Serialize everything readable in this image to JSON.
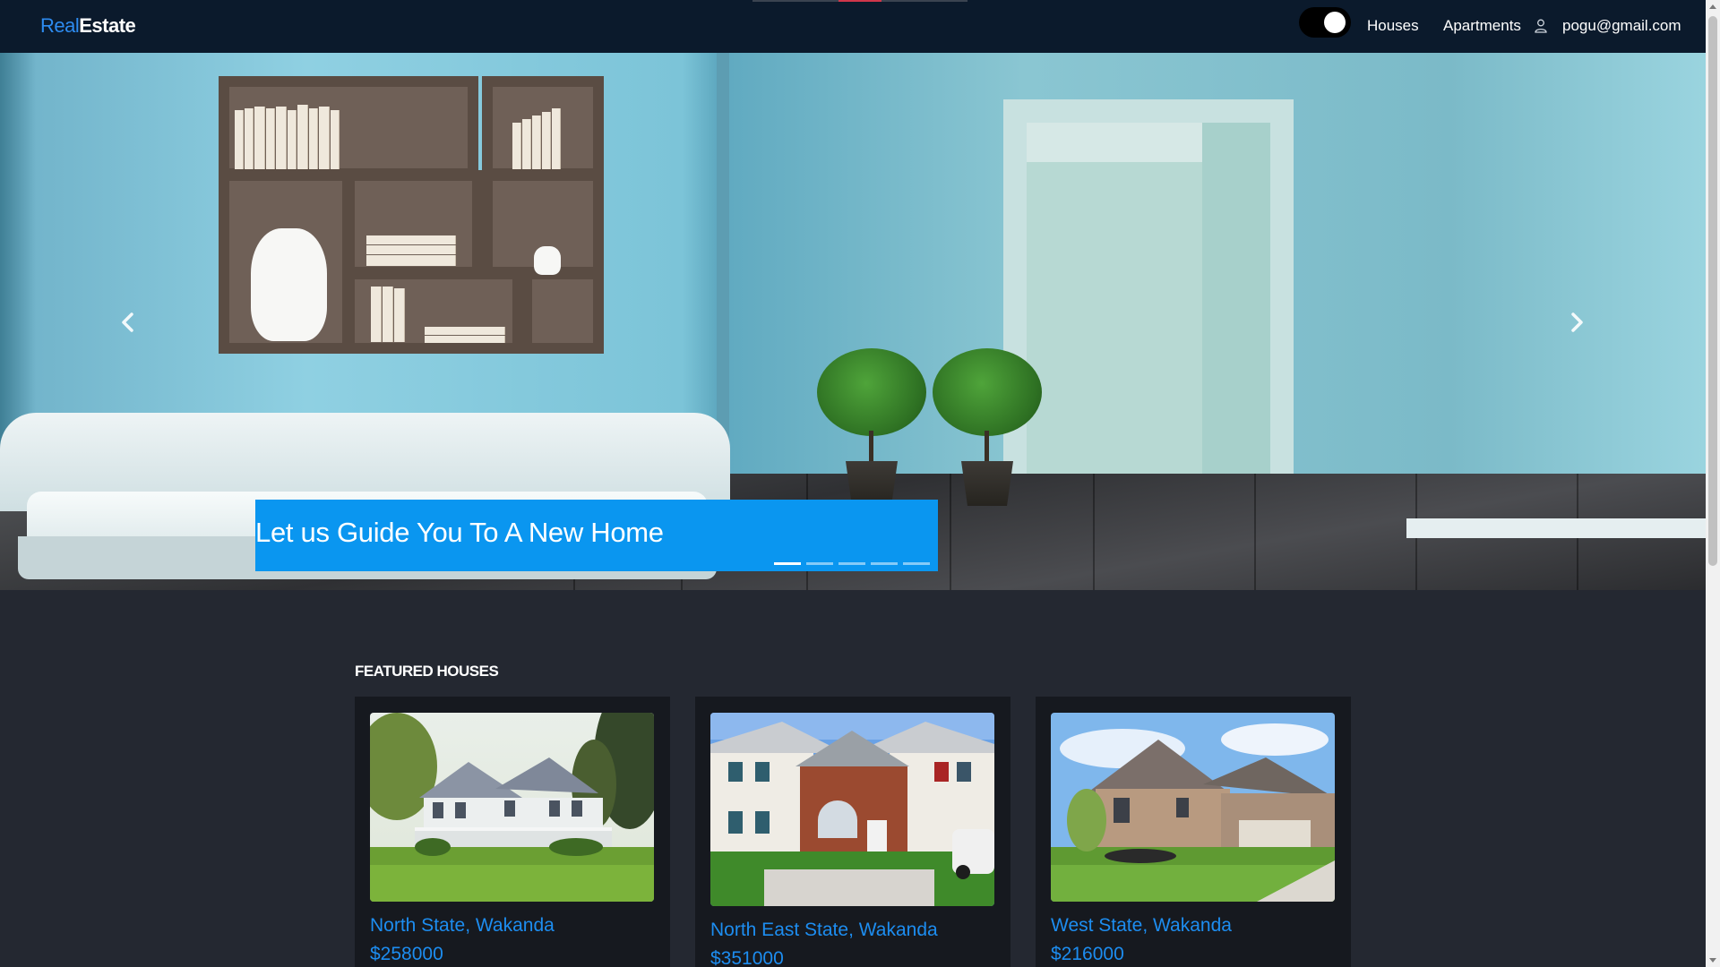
{
  "navbar": {
    "brand_part1": "Real",
    "brand_part2": "Estate",
    "links": [
      "Houses",
      "Apartments"
    ],
    "user_email": "pogu@gmail.com",
    "theme_toggle_on": true
  },
  "hero": {
    "caption": "Let us Guide You To A New Home",
    "slide_count": 5,
    "active_slide": 1,
    "prev_icon": "chevron-left-icon",
    "next_icon": "chevron-right-icon"
  },
  "featured": {
    "title": "FEATURED HOUSES",
    "cards": [
      {
        "location": "North State, Wakanda",
        "price": "$258000"
      },
      {
        "location": "North East State, Wakanda",
        "price": "$351000"
      },
      {
        "location": "West State, Wakanda",
        "price": "$216000"
      }
    ]
  },
  "colors": {
    "navbar_bg": "#0b1a2c",
    "page_bg": "#242831",
    "accent": "#0a96f0",
    "link_blue": "#1d8df0"
  }
}
